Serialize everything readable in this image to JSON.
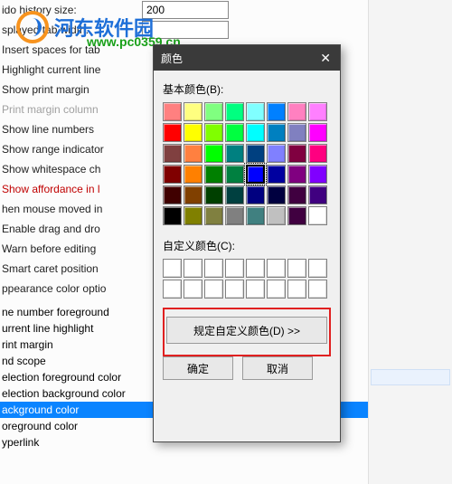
{
  "logo": {
    "text": "河东软件园",
    "url": "www.pc0359.cn"
  },
  "settings": {
    "rows": [
      {
        "label": "ido history size:",
        "value": "200",
        "input": true
      },
      {
        "label": "splayed tab width:",
        "value": "",
        "input": true
      },
      {
        "label": "Insert spaces for tab"
      },
      {
        "label": "Highlight current line"
      },
      {
        "label": "Show print margin"
      },
      {
        "label": "Print margin column",
        "grey": true
      },
      {
        "label": "Show line numbers"
      },
      {
        "label": "Show range indicator"
      },
      {
        "label": "Show whitespace ch"
      },
      {
        "label": "Show affordance in l",
        "red": true
      },
      {
        "label": "hen mouse moved in"
      },
      {
        "label": "Enable drag and dro"
      },
      {
        "label": "Warn before editing"
      },
      {
        "label": "Smart caret position"
      },
      {
        "label": "ppearance color optio"
      }
    ]
  },
  "listItems": [
    "ne number foreground",
    "urrent line highlight",
    "rint margin",
    "nd scope",
    "election foreground color",
    "election background color",
    "ackground color",
    "oreground color",
    "yperlink"
  ],
  "listSelectedIndex": 6,
  "dialog": {
    "title": "颜色",
    "basicLabel": "基本颜色(B):",
    "customLabel": "自定义颜色(C):",
    "defineBtn": "规定自定义颜色(D) >>",
    "ok": "确定",
    "cancel": "取消",
    "selectedBasic": 28,
    "basicColors": [
      "#ff8080",
      "#ffff80",
      "#80ff80",
      "#00ff80",
      "#80ffff",
      "#0080ff",
      "#ff80c0",
      "#ff80ff",
      "#ff0000",
      "#ffff00",
      "#80ff00",
      "#00ff40",
      "#00ffff",
      "#0080c0",
      "#8080c0",
      "#ff00ff",
      "#804040",
      "#ff8040",
      "#00ff00",
      "#008080",
      "#004080",
      "#8080ff",
      "#800040",
      "#ff0080",
      "#800000",
      "#ff8000",
      "#008000",
      "#008040",
      "#0000ff",
      "#0000a0",
      "#800080",
      "#8000ff",
      "#400000",
      "#804000",
      "#004000",
      "#004040",
      "#000080",
      "#000040",
      "#400040",
      "#400080",
      "#000000",
      "#808000",
      "#808040",
      "#808080",
      "#408080",
      "#c0c0c0",
      "#400040",
      "#ffffff"
    ],
    "customColors": [
      "#ffffff",
      "#ffffff",
      "#ffffff",
      "#ffffff",
      "#ffffff",
      "#ffffff",
      "#ffffff",
      "#ffffff",
      "#ffffff",
      "#ffffff",
      "#ffffff",
      "#ffffff",
      "#ffffff",
      "#ffffff",
      "#ffffff",
      "#ffffff"
    ]
  }
}
